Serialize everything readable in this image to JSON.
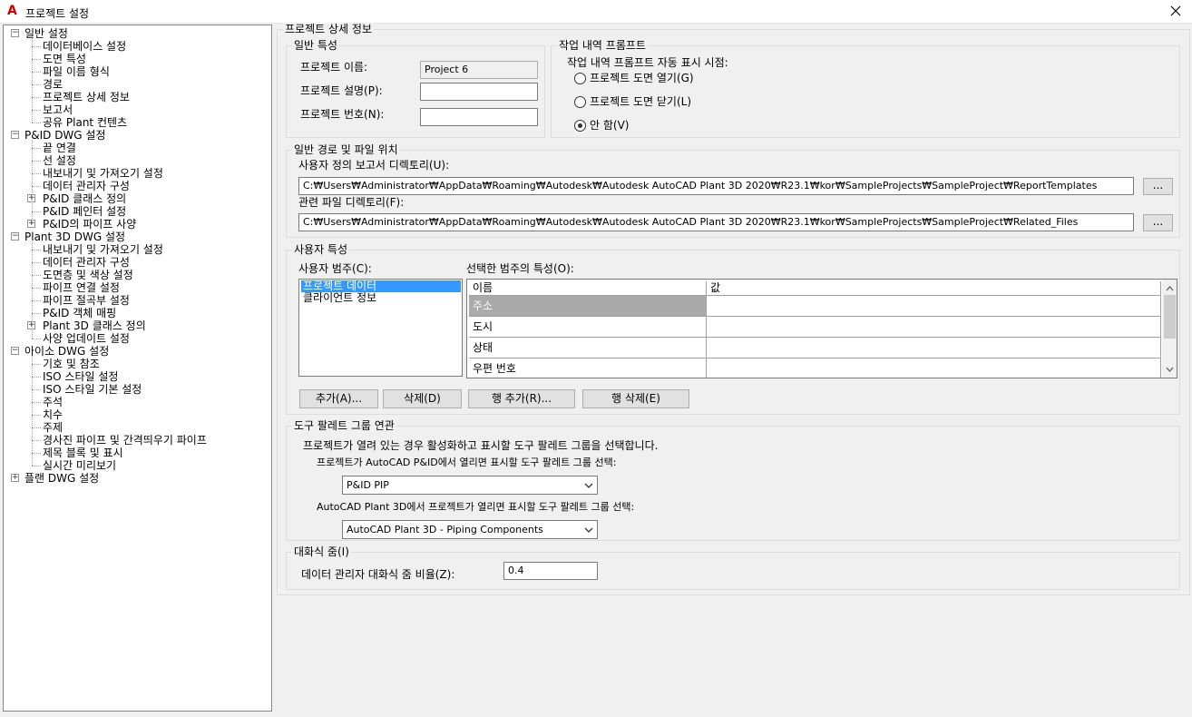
{
  "window": {
    "title": "프로젝트 설정",
    "app_icon": "A"
  },
  "tree": {
    "items": [
      {
        "label": "일반 설정",
        "level": 0,
        "expander": "−"
      },
      {
        "label": "데이터베이스 설정",
        "level": 1
      },
      {
        "label": "도면 특성",
        "level": 1
      },
      {
        "label": "파일 이름 형식",
        "level": 1
      },
      {
        "label": "경로",
        "level": 1
      },
      {
        "label": "프로젝트 상세 정보",
        "level": 1
      },
      {
        "label": "보고서",
        "level": 1
      },
      {
        "label": "공유 Plant 컨텐츠",
        "level": 1
      },
      {
        "label": "P&ID DWG 설정",
        "level": 0,
        "expander": "−"
      },
      {
        "label": "끝 연결",
        "level": 1
      },
      {
        "label": "선 설정",
        "level": 1
      },
      {
        "label": "내보내기 및 가져오기 설정",
        "level": 1
      },
      {
        "label": "데이터 관리자 구성",
        "level": 1
      },
      {
        "label": "P&ID 클래스 정의",
        "level": 1,
        "expander": "+"
      },
      {
        "label": "P&ID 페인터 설정",
        "level": 1
      },
      {
        "label": "P&ID의 파이프 사양",
        "level": 1,
        "expander": "+"
      },
      {
        "label": "Plant 3D DWG 설정",
        "level": 0,
        "expander": "−"
      },
      {
        "label": "내보내기 및 가져오기 설정",
        "level": 1
      },
      {
        "label": "데이터 관리자 구성",
        "level": 1
      },
      {
        "label": "도면층 및 색상 설정",
        "level": 1
      },
      {
        "label": "파이프 연결 설정",
        "level": 1
      },
      {
        "label": "파이프 절곡부 설정",
        "level": 1
      },
      {
        "label": "P&ID 객체 매핑",
        "level": 1
      },
      {
        "label": "Plant 3D 클래스 정의",
        "level": 1,
        "expander": "+"
      },
      {
        "label": "사양 업데이트 설정",
        "level": 1
      },
      {
        "label": "아이소 DWG 설정",
        "level": 0,
        "expander": "−"
      },
      {
        "label": "기호 및 참조",
        "level": 1
      },
      {
        "label": "ISO 스타일 설정",
        "level": 1
      },
      {
        "label": "ISO 스타일 기본 설정",
        "level": 1
      },
      {
        "label": "주석",
        "level": 1
      },
      {
        "label": "치수",
        "level": 1
      },
      {
        "label": "주제",
        "level": 1
      },
      {
        "label": "경사진 파이프 및 간격띄우기 파이프",
        "level": 1
      },
      {
        "label": "제목 블록 및 표시",
        "level": 1
      },
      {
        "label": "실시간 미리보기",
        "level": 1
      },
      {
        "label": "플랜 DWG 설정",
        "level": 0,
        "expander": "+"
      }
    ]
  },
  "details": {
    "title": "프로젝트 상세 정보",
    "general": {
      "title": "일반 특성",
      "name_label": "프로젝트 이름:",
      "name_value": "Project 6",
      "desc_label": "프로젝트 설명(P):",
      "desc_value": "",
      "number_label": "프로젝트 번호(N):",
      "number_value": ""
    },
    "history": {
      "title": "작업 내역 프롬프트",
      "prompt_label": "작업 내역 프롬프트 자동 표시 시점:",
      "options": [
        "프로젝트 도면 열기(G)",
        "프로젝트 도면 닫기(L)",
        "안 함(V)"
      ],
      "selected": 2
    },
    "paths": {
      "title": "일반 경로 및 파일 위치",
      "report_label": "사용자 정의 보고서 디렉토리(U):",
      "report_value": "C:₩Users₩Administrator₩AppData₩Roaming₩Autodesk₩Autodesk AutoCAD Plant 3D 2020₩R23.1₩kor₩SampleProjects₩SampleProject₩ReportTemplates",
      "related_label": "관련 파일 디렉토리(F):",
      "related_value": "C:₩Users₩Administrator₩AppData₩Roaming₩Autodesk₩Autodesk AutoCAD Plant 3D 2020₩R23.1₩kor₩SampleProjects₩SampleProject₩Related_Files",
      "browse_label": "..."
    },
    "user_props": {
      "title": "사용자 특성",
      "category_label": "사용자 범주(C):",
      "categories": [
        "프로젝트 데이터",
        "클라이언트 정보"
      ],
      "selected_category": 0,
      "props_label": "선택한 범주의 특성(O):",
      "columns": [
        "이름",
        "값"
      ],
      "rows": [
        {
          "name": "주소",
          "value": ""
        },
        {
          "name": "도시",
          "value": ""
        },
        {
          "name": "상태",
          "value": ""
        },
        {
          "name": "우편 번호",
          "value": ""
        }
      ],
      "add_button": "추가(A)...",
      "delete_button": "삭제(D)",
      "add_row_button": "행 추가(R)...",
      "delete_row_button": "행 삭제(E)"
    },
    "palette": {
      "title": "도구 팔레트 그룹 연관",
      "description": "프로젝트가 열려 있는 경우 활성화하고 표시할 도구 팔레트 그룹을 선택합니다.",
      "pid_label": "프로젝트가 AutoCAD P&ID에서 열리면 표시할 도구 팔레트 그룹 선택:",
      "pid_value": "P&ID PIP",
      "plant_label": "AutoCAD Plant 3D에서 프로젝트가 열리면 표시할 도구 팔레트 그룹 선택:",
      "plant_value": "AutoCAD Plant 3D - Piping Components"
    },
    "zoom": {
      "title": "대화식 줌(I)",
      "label": "데이터 관리자 대화식 줌 비율(Z):",
      "value": "0.4"
    }
  }
}
